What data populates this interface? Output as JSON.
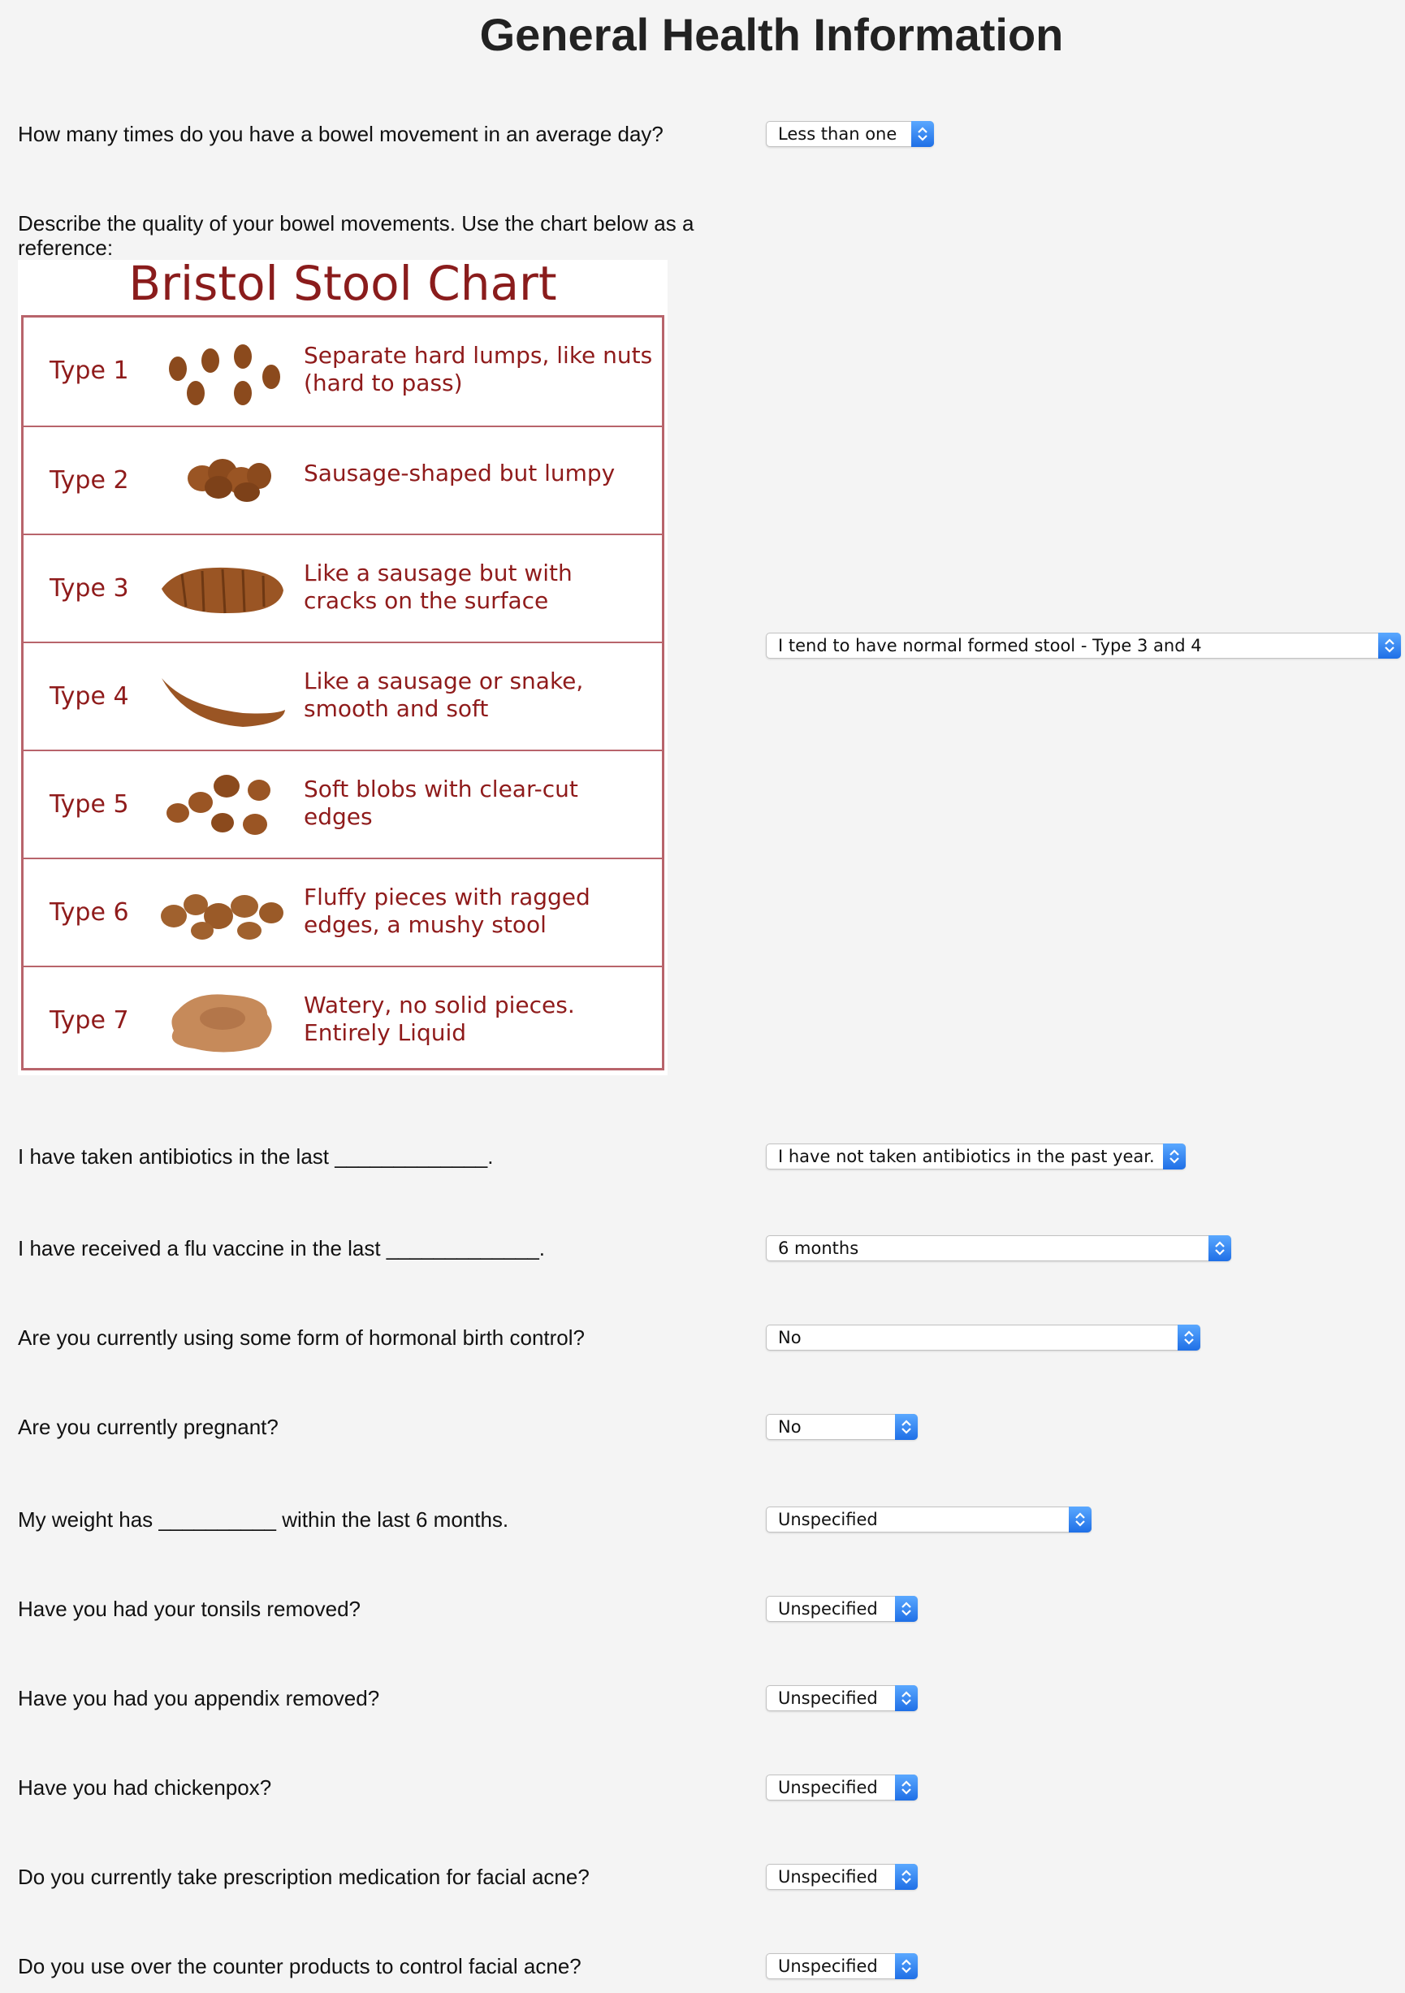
{
  "page": {
    "title": "General Health Information"
  },
  "questions": {
    "bowel_count": {
      "label": "How many times do you have a bowel movement in an average day?",
      "value": "Less than one"
    },
    "bowel_quality": {
      "label": "Describe the quality of your bowel movements. Use the chart below as a reference:",
      "value": "I tend to have normal formed stool - Type 3 and 4"
    },
    "antibiotics": {
      "label": "I have taken antibiotics in the last _____________.",
      "value": "I have not taken antibiotics in the past year."
    },
    "flu_vaccine": {
      "label": "I have received a flu vaccine in the last _____________.",
      "value": "6 months"
    },
    "birth_control": {
      "label": "Are you currently using some form of hormonal birth control?",
      "value": "No"
    },
    "pregnant": {
      "label": "Are you currently pregnant?",
      "value": "No"
    },
    "weight": {
      "label": "My weight has __________ within the last 6 months.",
      "value": "Unspecified"
    },
    "tonsils": {
      "label": "Have you had your tonsils removed?",
      "value": "Unspecified"
    },
    "appendix": {
      "label": "Have you had you appendix removed?",
      "value": "Unspecified"
    },
    "chickenpox": {
      "label": "Have you had chickenpox?",
      "value": "Unspecified"
    },
    "acne_rx": {
      "label": "Do you currently take prescription medication for facial acne?",
      "value": "Unspecified"
    },
    "acne_otc": {
      "label": "Do you use over the counter products to control facial acne?",
      "value": "Unspecified"
    }
  },
  "bristol_chart": {
    "title": "Bristol Stool Chart",
    "rows": [
      {
        "type": "Type 1",
        "desc1": "Separate hard lumps, like nuts",
        "desc2": "(hard to pass)"
      },
      {
        "type": "Type 2",
        "desc1": "Sausage-shaped but lumpy",
        "desc2": ""
      },
      {
        "type": "Type 3",
        "desc1": "Like a sausage but with",
        "desc2": "cracks on the surface"
      },
      {
        "type": "Type 4",
        "desc1": "Like a sausage or snake,",
        "desc2": "smooth and soft"
      },
      {
        "type": "Type 5",
        "desc1": "Soft blobs with clear-cut",
        "desc2": "edges"
      },
      {
        "type": "Type 6",
        "desc1": "Fluffy pieces with ragged",
        "desc2": "edges, a mushy stool"
      },
      {
        "type": "Type 7",
        "desc1": "Watery, no solid pieces.",
        "desc2": "Entirely Liquid"
      }
    ]
  },
  "colors": {
    "background": "#f4f4f4",
    "chart_text": "#8f1b1b",
    "chart_border": "#b8646b",
    "select_accent": "#1f6fe6"
  }
}
